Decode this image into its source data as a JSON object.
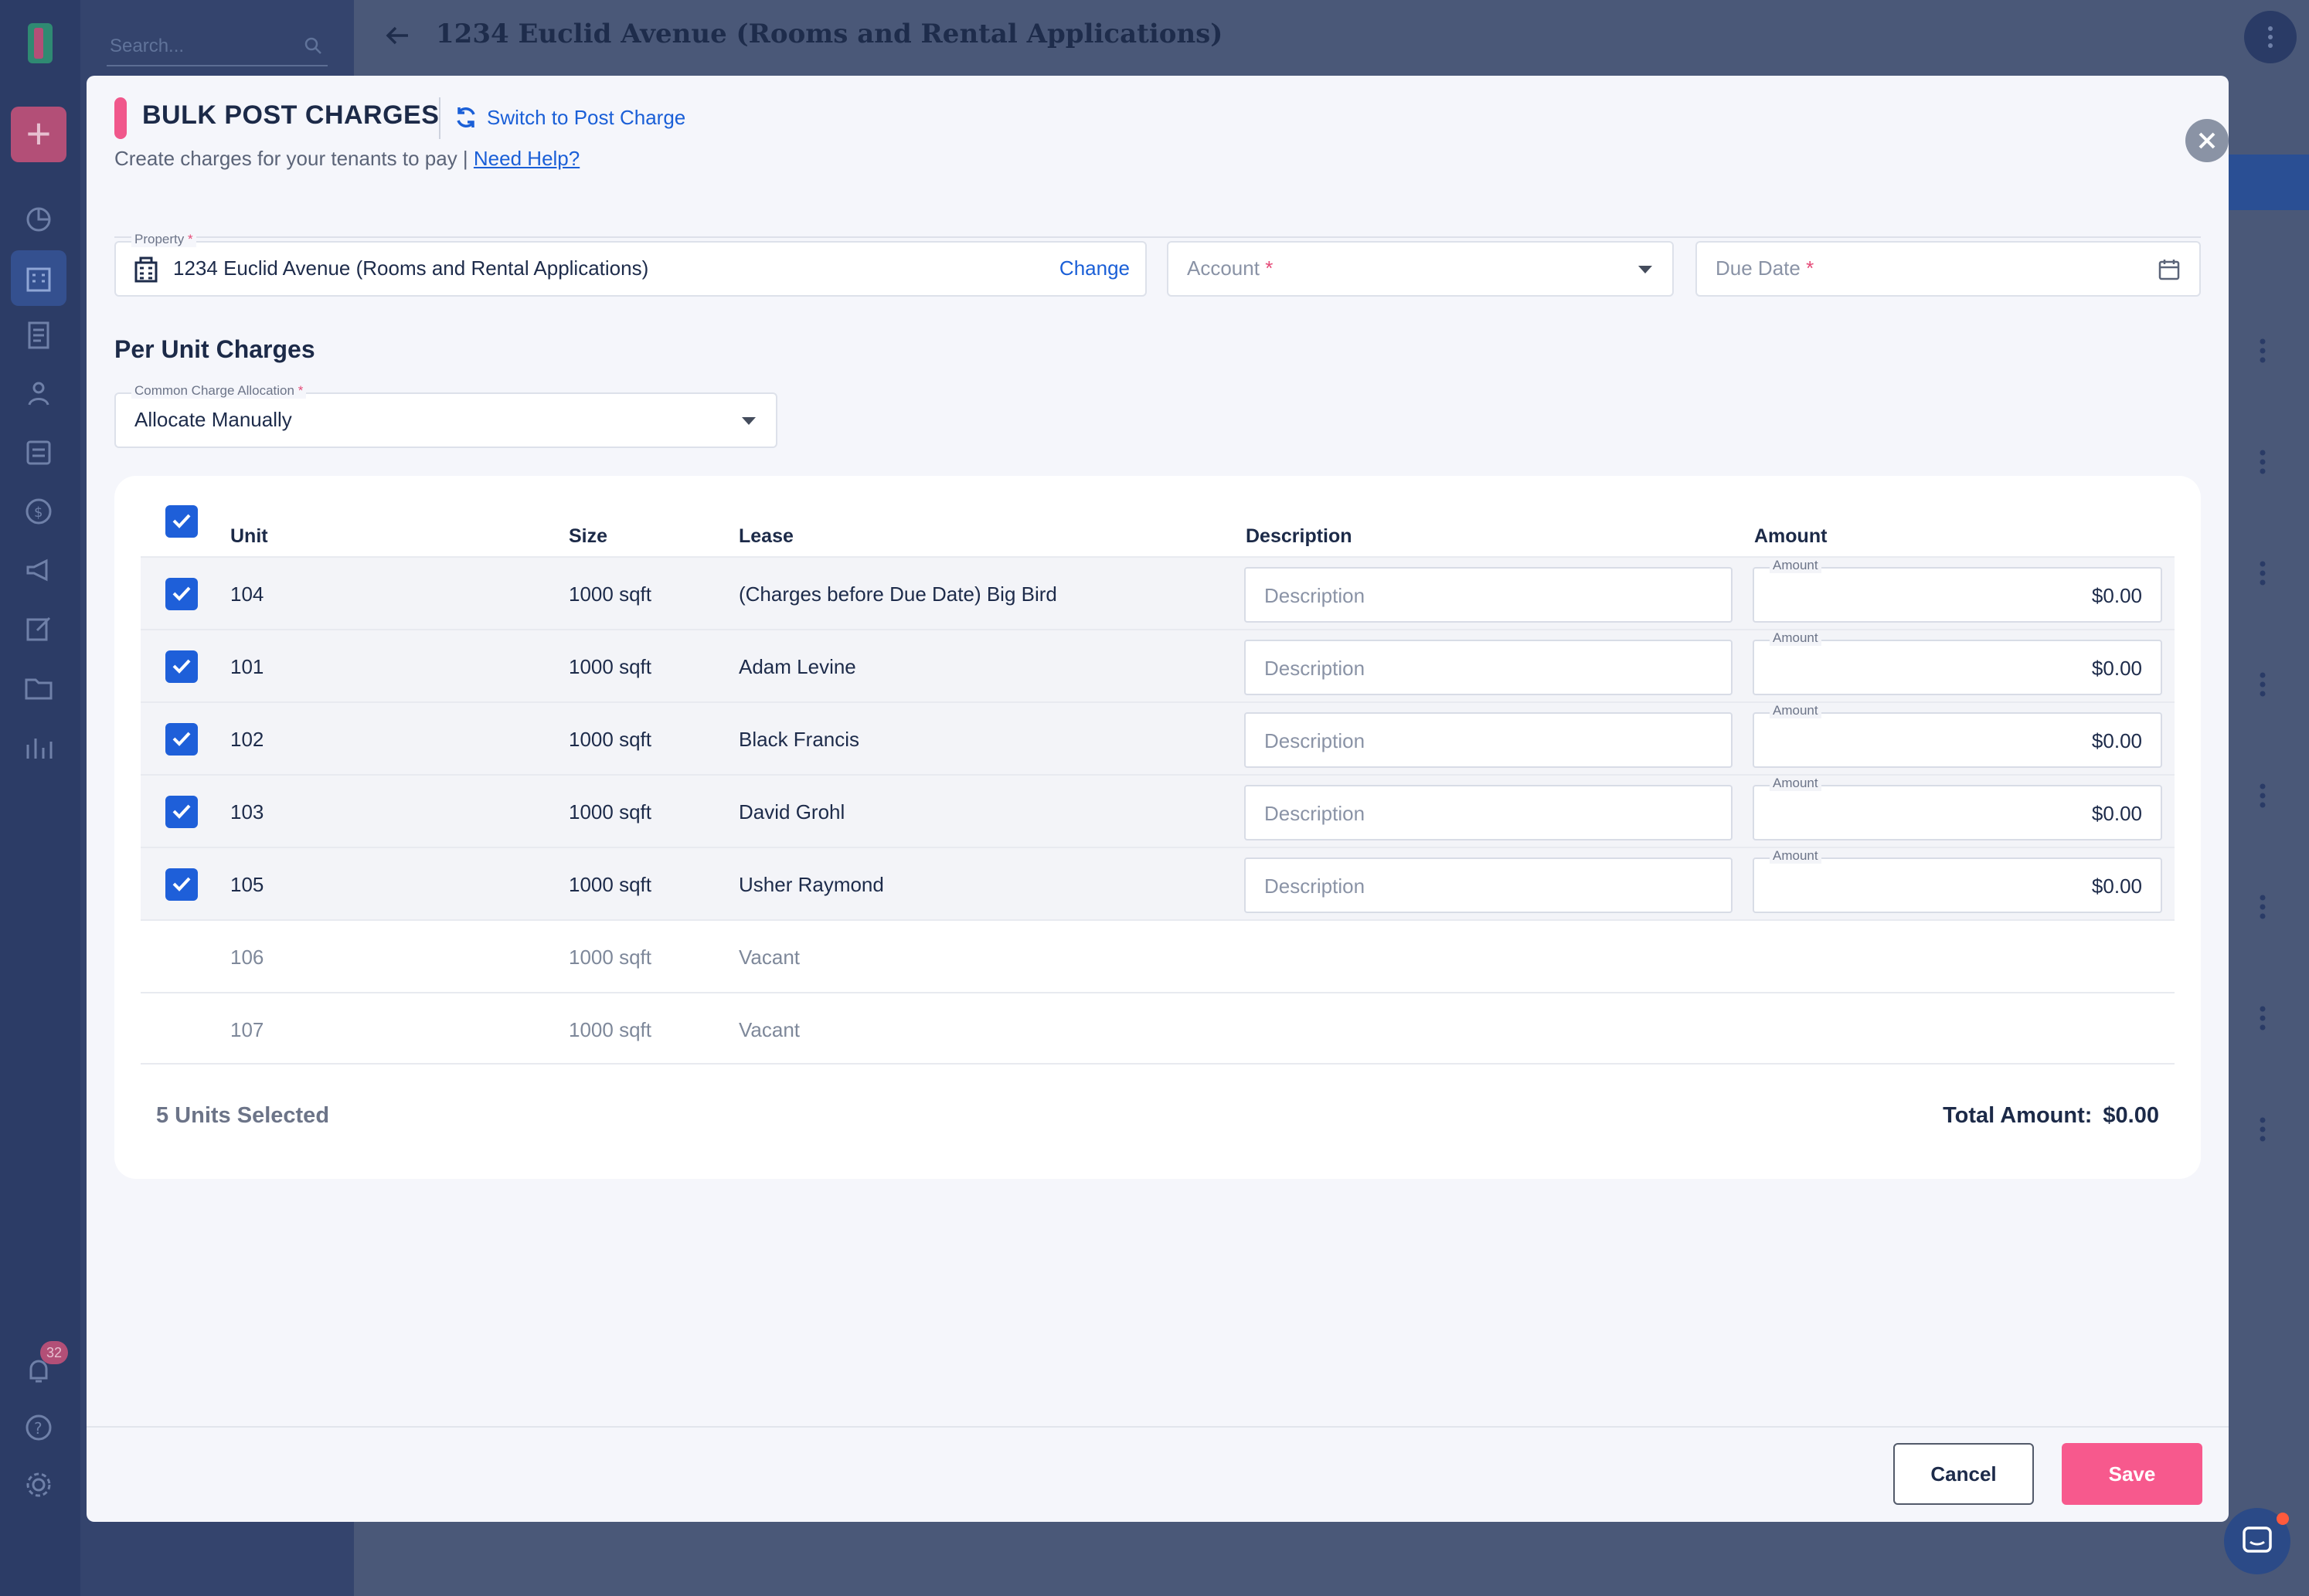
{
  "page": {
    "title": "1234 Euclid Avenue (Rooms and Rental Applications)",
    "search_placeholder": "Search...",
    "notifications_count": "32"
  },
  "modal": {
    "title": "BULK POST CHARGES",
    "switch_label": "Switch to Post Charge",
    "subtitle": "Create charges for your tenants to pay |",
    "help_link": "Need Help?",
    "property": {
      "label": "Property",
      "value": "1234 Euclid Avenue (Rooms and Rental Applications)",
      "change_label": "Change"
    },
    "account": {
      "placeholder": "Account"
    },
    "due_date": {
      "placeholder": "Due Date"
    },
    "required_mark": "*",
    "section_title": "Per Unit Charges",
    "allocation": {
      "label": "Common Charge Allocation",
      "value": "Allocate Manually"
    },
    "table": {
      "headers": {
        "unit": "Unit",
        "size": "Size",
        "lease": "Lease",
        "description": "Description",
        "amount": "Amount"
      },
      "description_placeholder": "Description",
      "amount_label": "Amount",
      "rows": [
        {
          "unit": "104",
          "size": "1000 sqft",
          "lease": "(Charges before Due Date) Big Bird",
          "amount": "$0.00",
          "selected": true
        },
        {
          "unit": "101",
          "size": "1000 sqft",
          "lease": "Adam Levine",
          "amount": "$0.00",
          "selected": true
        },
        {
          "unit": "102",
          "size": "1000 sqft",
          "lease": "Black Francis",
          "amount": "$0.00",
          "selected": true
        },
        {
          "unit": "103",
          "size": "1000 sqft",
          "lease": "David Grohl",
          "amount": "$0.00",
          "selected": true
        },
        {
          "unit": "105",
          "size": "1000 sqft",
          "lease": "Usher Raymond",
          "amount": "$0.00",
          "selected": true
        },
        {
          "unit": "106",
          "size": "1000 sqft",
          "lease": "Vacant",
          "selected": false
        },
        {
          "unit": "107",
          "size": "1000 sqft",
          "lease": "Vacant",
          "selected": false
        }
      ]
    },
    "units_selected": "5 Units Selected",
    "total_label": "Total Amount:",
    "total_value": "$0.00",
    "cancel_label": "Cancel",
    "save_label": "Save"
  },
  "colors": {
    "accent": "#f0578b",
    "primary": "#1e5fd9",
    "save": "#f7598d",
    "overlay_bg": "#4a5878"
  },
  "icons": [
    "building-icon",
    "refresh-icon",
    "close-icon",
    "calendar-icon",
    "caret-down-icon",
    "check-icon",
    "back-arrow-icon",
    "kebab-icon",
    "chat-icon",
    "bell-icon",
    "help-icon",
    "gear-icon"
  ]
}
